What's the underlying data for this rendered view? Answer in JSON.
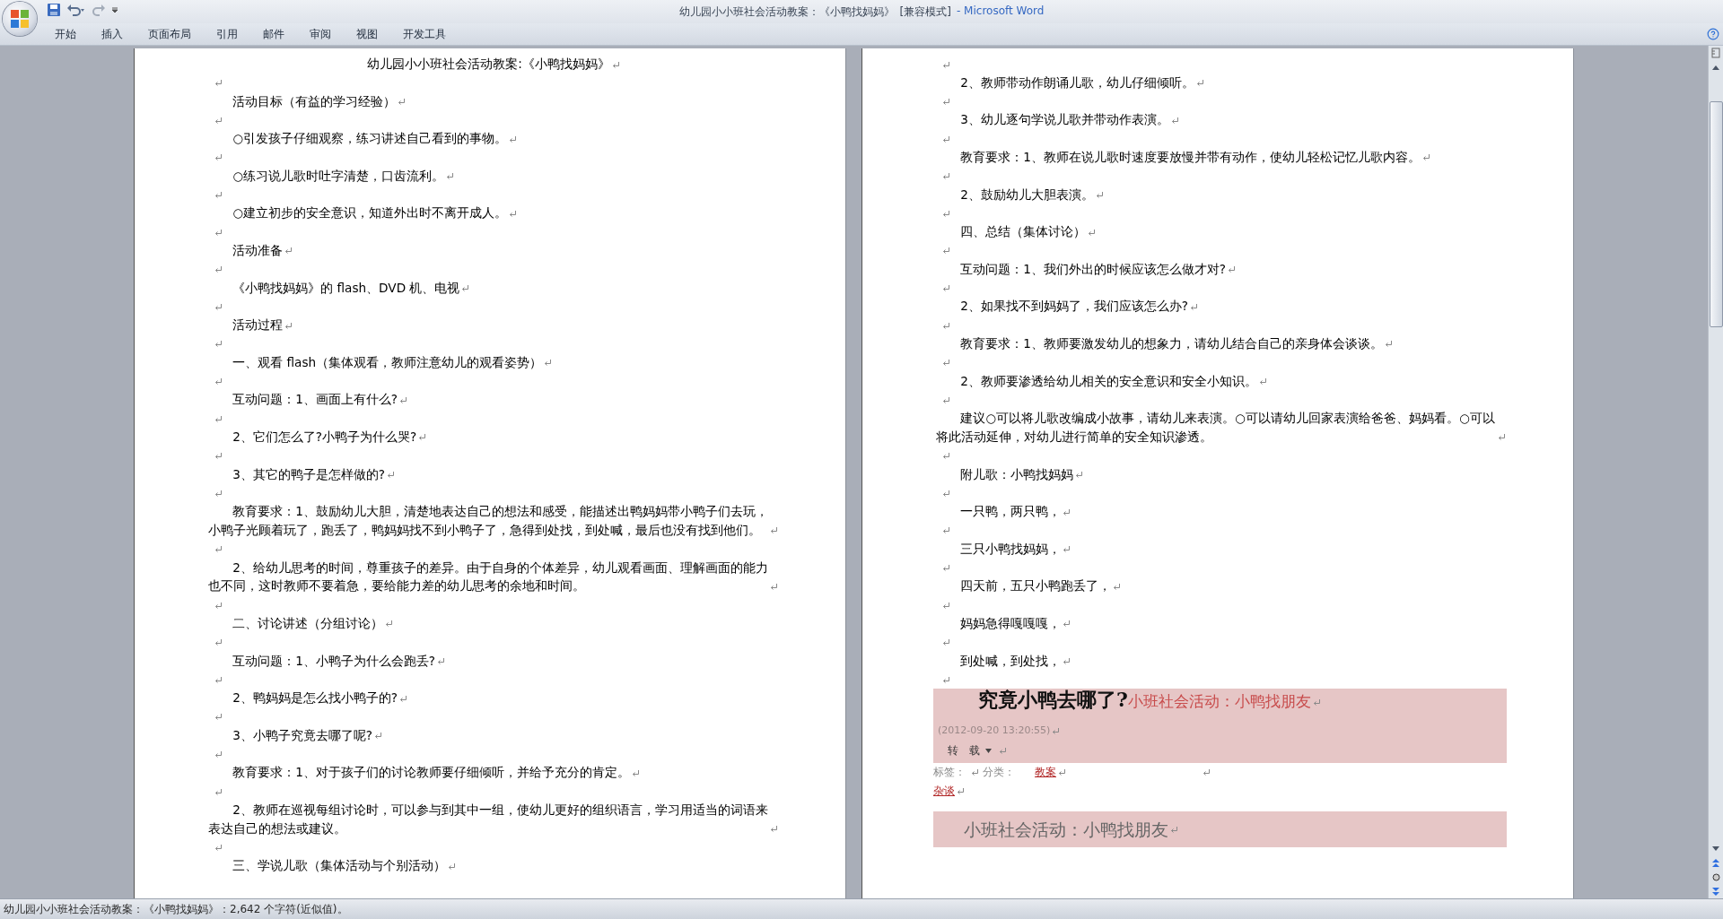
{
  "window": {
    "title": "幼儿园小小班社会活动教案：《小鸭找妈妈》",
    "mode": "[兼容模式]",
    "app": "- Microsoft Word"
  },
  "ribbon_tabs": [
    "开始",
    "插入",
    "页面布局",
    "引用",
    "邮件",
    "审阅",
    "视图",
    "开发工具"
  ],
  "pages": [
    {
      "paragraphs": [
        {
          "kind": "title",
          "text": "幼儿园小小班社会活动教案:《小鸭找妈妈》"
        },
        {
          "kind": "blank"
        },
        {
          "kind": "text",
          "text": "活动目标（有益的学习经验）"
        },
        {
          "kind": "blank"
        },
        {
          "kind": "text",
          "text": "○引发孩子仔细观察，练习讲述自己看到的事物。"
        },
        {
          "kind": "blank"
        },
        {
          "kind": "text",
          "text": "○练习说儿歌时吐字清楚，口齿流利。"
        },
        {
          "kind": "blank"
        },
        {
          "kind": "text",
          "text": "○建立初步的安全意识，知道外出时不离开成人。"
        },
        {
          "kind": "blank"
        },
        {
          "kind": "text",
          "text": "活动准备"
        },
        {
          "kind": "blank"
        },
        {
          "kind": "text",
          "text": "《小鸭找妈妈》的 flash、DVD 机、电视"
        },
        {
          "kind": "blank"
        },
        {
          "kind": "text",
          "text": "活动过程"
        },
        {
          "kind": "blank"
        },
        {
          "kind": "text",
          "text": "一、观看 flash（集体观看，教师注意幼儿的观看姿势）"
        },
        {
          "kind": "blank"
        },
        {
          "kind": "text",
          "text": "互动问题：1、画面上有什么?"
        },
        {
          "kind": "blank"
        },
        {
          "kind": "text",
          "text": "2、它们怎么了?小鸭子为什么哭?"
        },
        {
          "kind": "blank"
        },
        {
          "kind": "text",
          "text": "3、其它的鸭子是怎样做的?"
        },
        {
          "kind": "blank"
        },
        {
          "kind": "text",
          "text": "教育要求：1、鼓励幼儿大胆，清楚地表达自己的想法和感受，能描述出鸭妈妈带小鸭子们去玩，小鸭子光顾着玩了，跑丢了，鸭妈妈找不到小鸭子了，急得到处找，到处喊，最后也没有找到他们。"
        },
        {
          "kind": "blank"
        },
        {
          "kind": "text",
          "text": "2、给幼儿思考的时间，尊重孩子的差异。由于自身的个体差异，幼儿观看画面、理解画面的能力也不同，这时教师不要着急，要给能力差的幼儿思考的余地和时间。"
        },
        {
          "kind": "blank"
        },
        {
          "kind": "text",
          "text": "二、讨论讲述（分组讨论）"
        },
        {
          "kind": "blank"
        },
        {
          "kind": "text",
          "text": "互动问题：1、小鸭子为什么会跑丢?"
        },
        {
          "kind": "blank"
        },
        {
          "kind": "text",
          "text": "2、鸭妈妈是怎么找小鸭子的?"
        },
        {
          "kind": "blank"
        },
        {
          "kind": "text",
          "text": "3、小鸭子究竟去哪了呢?"
        },
        {
          "kind": "blank"
        },
        {
          "kind": "text",
          "text": "教育要求：1、对于孩子们的讨论教师要仔细倾听，并给予充分的肯定。"
        },
        {
          "kind": "blank"
        },
        {
          "kind": "text",
          "text": "2、教师在巡视每组讨论时，可以参与到其中一组，使幼儿更好的组织语言，学习用适当的词语来表达自己的想法或建议。"
        },
        {
          "kind": "blank"
        },
        {
          "kind": "text",
          "text": "三、学说儿歌（集体活动与个别活动）"
        }
      ]
    },
    {
      "paragraphs": [
        {
          "kind": "blank"
        },
        {
          "kind": "text",
          "text": "2、教师带动作朗诵儿歌，幼儿仔细倾听。"
        },
        {
          "kind": "blank"
        },
        {
          "kind": "text",
          "text": "3、幼儿逐句学说儿歌并带动作表演。"
        },
        {
          "kind": "blank"
        },
        {
          "kind": "text",
          "text": "教育要求：1、教师在说儿歌时速度要放慢并带有动作，使幼儿轻松记忆儿歌内容。"
        },
        {
          "kind": "blank"
        },
        {
          "kind": "text",
          "text": "2、鼓励幼儿大胆表演。"
        },
        {
          "kind": "blank"
        },
        {
          "kind": "text",
          "text": "四、总结（集体讨论）"
        },
        {
          "kind": "blank"
        },
        {
          "kind": "text",
          "text": "互动问题：1、我们外出的时候应该怎么做才对?"
        },
        {
          "kind": "blank"
        },
        {
          "kind": "text",
          "text": "2、如果找不到妈妈了，我们应该怎么办?"
        },
        {
          "kind": "blank"
        },
        {
          "kind": "text",
          "text": "教育要求：1、教师要激发幼儿的想象力，请幼儿结合自己的亲身体会谈谈。"
        },
        {
          "kind": "blank"
        },
        {
          "kind": "text",
          "text": "2、教师要渗透给幼儿相关的安全意识和安全小知识。"
        },
        {
          "kind": "blank"
        },
        {
          "kind": "text",
          "text": "建议○可以将儿歌改编成小故事，请幼儿来表演。○可以请幼儿回家表演给爸爸、妈妈看。○可以将此活动延伸，对幼儿进行简单的安全知识渗透。"
        },
        {
          "kind": "blank"
        },
        {
          "kind": "text",
          "text": "附儿歌：小鸭找妈妈"
        },
        {
          "kind": "blank"
        },
        {
          "kind": "text",
          "text": "一只鸭，两只鸭，"
        },
        {
          "kind": "blank"
        },
        {
          "kind": "text",
          "text": "三只小鸭找妈妈，"
        },
        {
          "kind": "blank"
        },
        {
          "kind": "text",
          "text": "四天前，五只小鸭跑丢了，"
        },
        {
          "kind": "blank"
        },
        {
          "kind": "text",
          "text": "妈妈急得嘎嘎嘎，"
        },
        {
          "kind": "blank"
        },
        {
          "kind": "text",
          "text": "到处喊，到处找，"
        },
        {
          "kind": "blank"
        }
      ],
      "web_clip": {
        "heading": "究竟小鸭去哪了?",
        "subtitle": "小班社会活动：小鸭找朋友",
        "timestamp": "(2012-09-20 13:20:55)",
        "repost": "转　载",
        "tags_label": "标签：",
        "category_label": "分类：",
        "category_link": "教案",
        "tag_link": "杂谈",
        "footer_title": "小班社会活动：小鸭找朋友"
      }
    }
  ],
  "status_bar": "幼儿园小小班社会活动教案：《小鸭找妈妈》：2,642 个字符(近似值)。"
}
